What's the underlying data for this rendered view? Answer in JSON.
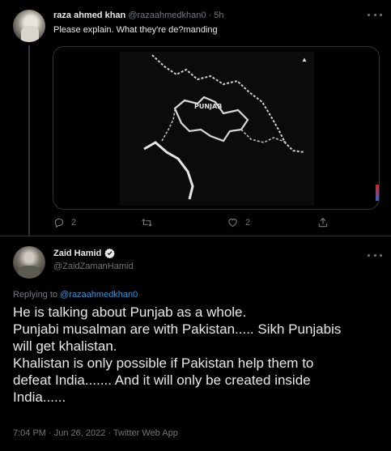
{
  "reply_tweet": {
    "author_name": "raza ahmed khan",
    "author_handle": "@razaahmedkhan0",
    "separator": "·",
    "time": "5h",
    "text": "Please explain. What they're de?manding",
    "video": {
      "map_label": "PUNJAB"
    },
    "actions": {
      "replies": "2",
      "retweets": "",
      "likes": "2"
    }
  },
  "main_tweet": {
    "author_name": "Zaid Hamid",
    "author_handle": "@ZaidZamanHamid",
    "replying_to_label": "Replying to",
    "replying_to_handle": "@razaahmedkhan0",
    "text_lines": [
      "He is talking about Punjab as a whole.",
      "Punjabi musalman are with Pakistan..... Sikh Punjabis",
      "will get khalistan.",
      "Khalistan is only possible if Pakistan help them to",
      "defeat India....... And it will only be created inside",
      "India......"
    ],
    "timestamp": "7:04 PM · Jun 26, 2022 · Twitter Web App"
  },
  "colors": {
    "background": "#000000",
    "text": "#e7e9ea",
    "muted": "#71767b",
    "link": "#1d9bf0",
    "border": "#2f3336",
    "verified": "#1d9bf0"
  },
  "icons": [
    "more-icon",
    "reply-icon",
    "retweet-icon",
    "like-icon",
    "share-icon",
    "verified-icon"
  ]
}
